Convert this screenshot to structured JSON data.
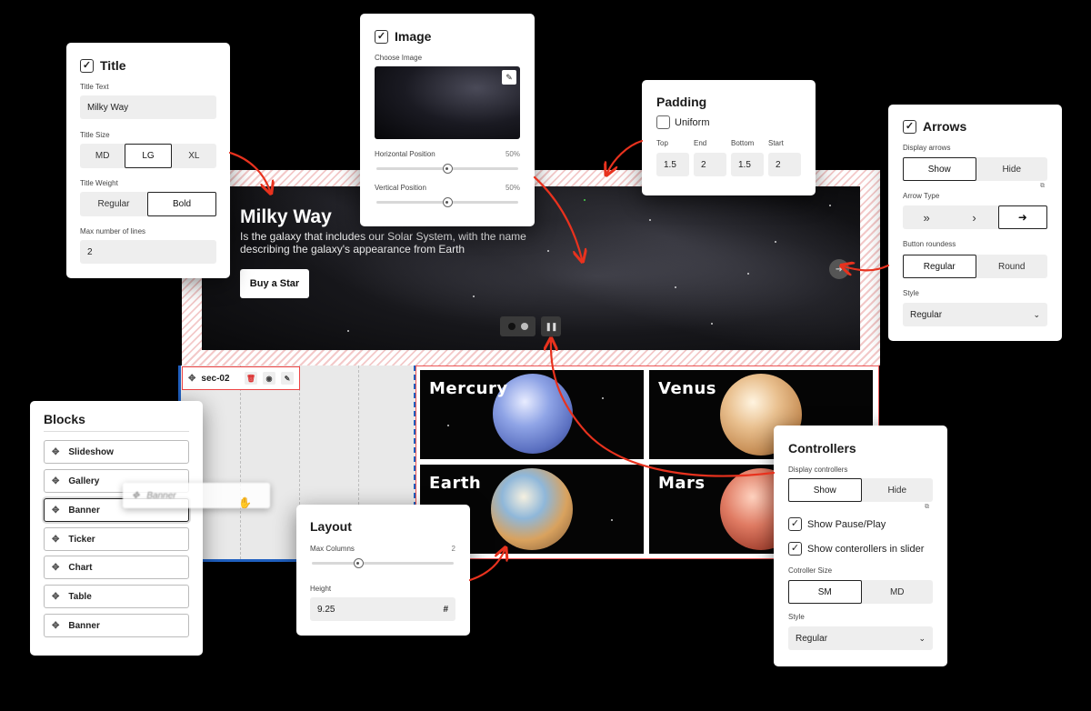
{
  "hero": {
    "title": "Milky Way",
    "text": "Is the galaxy that includes our Solar System, with the name describing the galaxy's appearance from Earth",
    "button": "Buy a Star"
  },
  "section": {
    "name": "sec-02"
  },
  "gallery": {
    "tiles": [
      "Mercury",
      "Venus",
      "Earth",
      "Mars"
    ]
  },
  "title_panel": {
    "heading": "Title",
    "text_label": "Title Text",
    "text_value": "Milky Way",
    "size_label": "Title Size",
    "sizes": [
      "MD",
      "LG",
      "XL"
    ],
    "selected_size": "LG",
    "weight_label": "Title Weight",
    "weights": [
      "Regular",
      "Bold"
    ],
    "selected_weight": "Bold",
    "lines_label": "Max number of lines",
    "lines_value": "2"
  },
  "image_panel": {
    "heading": "Image",
    "choose_label": "Choose Image",
    "hpos_label": "Horizontal Position",
    "hpos_value": "50%",
    "hpos_fraction": 0.5,
    "vpos_label": "Vertical Position",
    "vpos_value": "50%",
    "vpos_fraction": 0.5
  },
  "padding_panel": {
    "heading": "Padding",
    "uniform_label": "Uniform",
    "top_label": "Top",
    "top_value": "1.5",
    "end_label": "End",
    "end_value": "2",
    "bottom_label": "Bottom",
    "bottom_value": "1.5",
    "start_label": "Start",
    "start_value": "2"
  },
  "arrows_panel": {
    "heading": "Arrows",
    "display_label": "Display arrows",
    "display_options": [
      "Show",
      "Hide"
    ],
    "type_label": "Arrow Type",
    "types": [
      "»",
      "›",
      "➜"
    ],
    "roundness_label": "Button roundess",
    "roundness_options": [
      "Regular",
      "Round"
    ],
    "style_label": "Style",
    "style_value": "Regular"
  },
  "blocks_panel": {
    "heading": "Blocks",
    "items": [
      "Slideshow",
      "Gallery",
      "Banner",
      "Ticker",
      "Chart",
      "Table",
      "Banner"
    ],
    "ghost_label": "Banner"
  },
  "layout_panel": {
    "heading": "Layout",
    "columns_label": "Max Columns",
    "columns_value": "2",
    "columns_fraction": 0.33,
    "height_label": "Height",
    "height_value": "9.25",
    "height_unit": "#"
  },
  "controllers_panel": {
    "heading": "Controllers",
    "display_label": "Display controllers",
    "display_options": [
      "Show",
      "Hide"
    ],
    "pause_label": "Show Pause/Play",
    "slider_label": "Show conterollers in slider",
    "size_label": "Cotroller Size",
    "sizes": [
      "SM",
      "MD"
    ],
    "style_label": "Style",
    "style_value": "Regular"
  },
  "colors": {
    "accent": "#e8321e",
    "selection": "#1f5fbf"
  }
}
